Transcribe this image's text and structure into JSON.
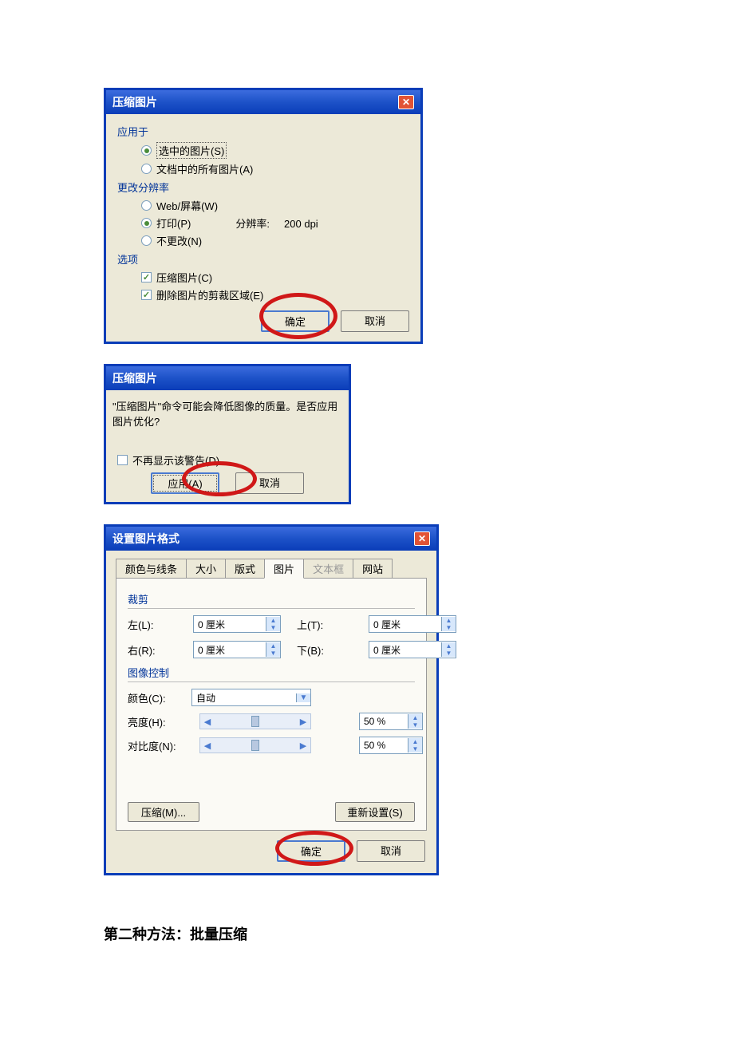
{
  "dialog1": {
    "title": "压缩图片",
    "section_apply": "应用于",
    "radio_selected": "选中的图片(S)",
    "radio_all": "文档中的所有图片(A)",
    "section_res": "更改分辨率",
    "radio_web": "Web/屏幕(W)",
    "radio_print": "打印(P)",
    "radio_nochange": "不更改(N)",
    "res_label": "分辨率:",
    "res_value": "200 dpi",
    "section_opts": "选项",
    "check_compress": "压缩图片(C)",
    "check_delete": "删除图片的剪裁区域(E)",
    "ok": "确定",
    "cancel": "取消"
  },
  "dialog2": {
    "title": "压缩图片",
    "message": "\"压缩图片\"命令可能会降低图像的质量。是否应用图片优化?",
    "check_noshow": "不再显示该警告(D)",
    "apply": "应用(A)",
    "cancel": "取消"
  },
  "dialog3": {
    "title": "设置图片格式",
    "tabs": {
      "color": "颜色与线条",
      "size": "大小",
      "layout": "版式",
      "picture": "图片",
      "textbox": "文本框",
      "web": "网站"
    },
    "crop_label": "裁剪",
    "left_label": "左(L):",
    "right_label": "右(R):",
    "top_label": "上(T):",
    "bottom_label": "下(B):",
    "crop_value": "0 厘米",
    "imgctrl_label": "图像控制",
    "color_label": "颜色(C):",
    "color_value": "自动",
    "brightness_label": "亮度(H):",
    "contrast_label": "对比度(N):",
    "percent": "50 %",
    "compress_btn": "压缩(M)...",
    "reset_btn": "重新设置(S)",
    "ok": "确定",
    "cancel": "取消"
  },
  "heading": "第二种方法：批量压缩"
}
